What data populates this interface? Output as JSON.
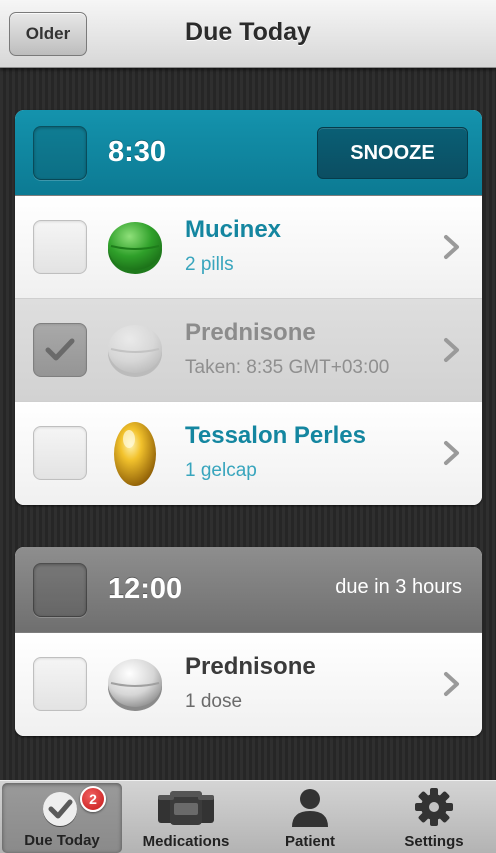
{
  "header": {
    "back_label": "Older",
    "title": "Due Today"
  },
  "groups": [
    {
      "time": "8:30",
      "action_label": "SNOOZE",
      "status": "",
      "items": [
        {
          "name": "Mucinex",
          "detail": "2 pills",
          "pill": "green-tablet",
          "taken": false
        },
        {
          "name": "Prednisone",
          "detail": "Taken: 8:35 GMT+03:00",
          "pill": "white-tablet",
          "taken": true
        },
        {
          "name": "Tessalon Perles",
          "detail": "1 gelcap",
          "pill": "gold-gelcap",
          "taken": false
        }
      ]
    },
    {
      "time": "12:00",
      "status": "due in 3 hours",
      "items": [
        {
          "name": "Prednisone",
          "detail": "1 dose",
          "pill": "white-tablet",
          "taken": false
        }
      ]
    }
  ],
  "tabs": [
    {
      "label": "Due Today",
      "icon": "checkmark-circle-icon",
      "badge": "2",
      "selected": true
    },
    {
      "label": "Medications",
      "icon": "pill-bottles-icon",
      "selected": false
    },
    {
      "label": "Patient",
      "icon": "person-icon",
      "selected": false
    },
    {
      "label": "Settings",
      "icon": "gear-icon",
      "selected": false
    }
  ],
  "colors": {
    "accent": "#1486a0",
    "active_header": "#1493ad",
    "upcoming_header": "#7f7f7f",
    "badge": "#d32020"
  }
}
